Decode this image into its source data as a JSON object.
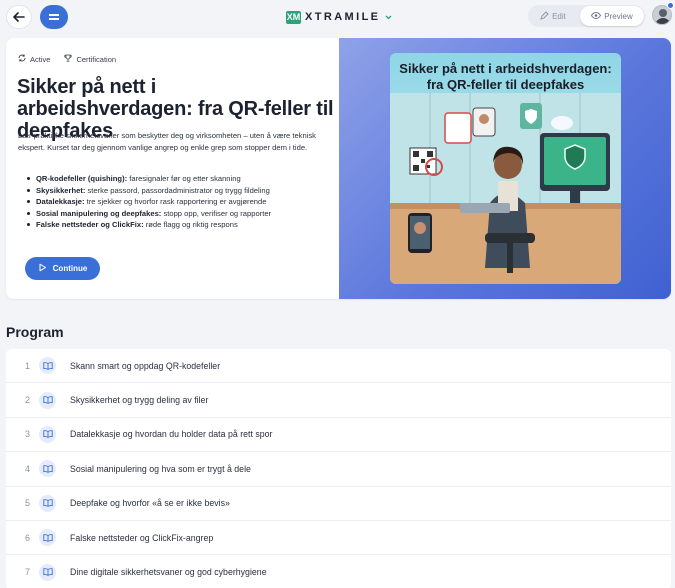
{
  "topbar": {
    "back_icon": "arrow-left-icon",
    "menu_icon": "menu-icon",
    "logo_text": "XTRAMILE",
    "logo_mark": "XM",
    "edit_label": "Edit",
    "preview_label": "Preview",
    "accent": "#3b6fd8"
  },
  "hero": {
    "tags": [
      {
        "label": "Active",
        "icon": "active-status-icon"
      },
      {
        "label": "Certification",
        "icon": "trophy-icon"
      }
    ],
    "title": "Sikker på nett i arbeidshverdagen: fra QR-feller til deepfakes",
    "description": "Lær praktiske sikkerhetsvaner som beskytter deg og virksomheten – uten å være teknisk ekspert. Kurset tar deg gjennom vanlige angrep og enkle grep som stopper dem i tide.",
    "bullets": [
      {
        "term": "QR-kodefeller (quishing):",
        "text": " faresignaler før og etter skanning"
      },
      {
        "term": "Skysikkerhet:",
        "text": " sterke passord, passordadministrator og trygg fildeling"
      },
      {
        "term": "Datalekkasje:",
        "text": " tre sjekker og hvorfor rask rapportering er avgjørende"
      },
      {
        "term": "Sosial manipulering og deepfakes:",
        "text": " stopp opp, verifiser og rapporter"
      },
      {
        "term": "Falske nettsteder og ClickFix:",
        "text": " røde flagg og riktig respons"
      }
    ],
    "continue_label": "Continue",
    "image_title": "Sikker på nett i arbeidshverdagen: fra QR-feller til deepfakes"
  },
  "program": {
    "title": "Program",
    "items": [
      {
        "num": "1",
        "label": "Skann smart og oppdag QR-kodefeller"
      },
      {
        "num": "2",
        "label": "Skysikkerhet og trygg deling av filer"
      },
      {
        "num": "3",
        "label": "Datalekkasje og hvordan du holder data på rett spor"
      },
      {
        "num": "4",
        "label": "Sosial manipulering og hva som er trygt å dele"
      },
      {
        "num": "5",
        "label": "Deepfake og hvorfor «å se er ikke bevis»"
      },
      {
        "num": "6",
        "label": "Falske nettsteder og ClickFix-angrep"
      },
      {
        "num": "7",
        "label": "Dine digitale sikkerhetsvaner og god cyberhygiene"
      }
    ]
  }
}
